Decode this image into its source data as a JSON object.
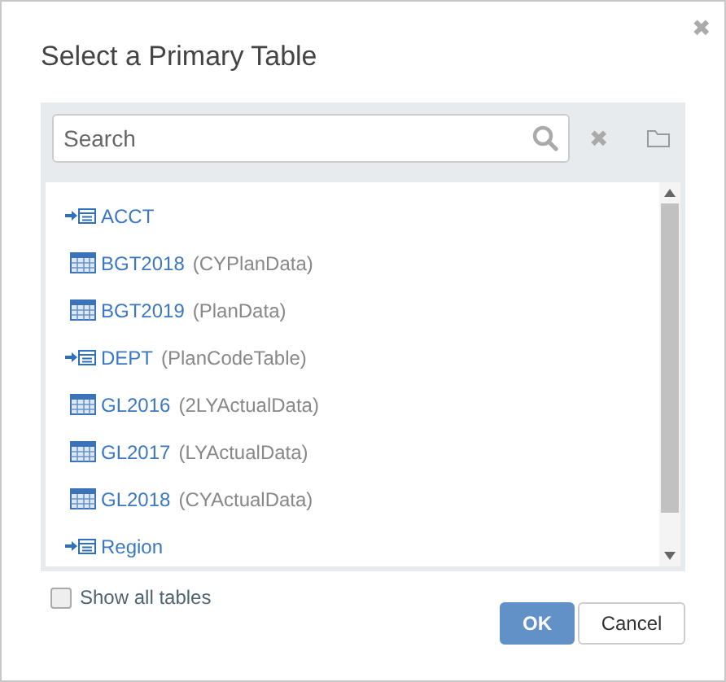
{
  "dialog": {
    "title": "Select a Primary Table",
    "close": "✖"
  },
  "search": {
    "placeholder": "Search",
    "clear": "✖"
  },
  "tables": [
    {
      "kind": "link",
      "name": "ACCT"
    },
    {
      "kind": "table",
      "name": "BGT2018",
      "alias": "(CYPlanData)"
    },
    {
      "kind": "table",
      "name": "BGT2019",
      "alias": "(PlanData)"
    },
    {
      "kind": "link",
      "name": "DEPT",
      "alias": "(PlanCodeTable)"
    },
    {
      "kind": "table",
      "name": "GL2016",
      "alias": "(2LYActualData)"
    },
    {
      "kind": "table",
      "name": "GL2017",
      "alias": "(LYActualData)"
    },
    {
      "kind": "table",
      "name": "GL2018",
      "alias": "(CYActualData)"
    },
    {
      "kind": "link",
      "name": "Region"
    }
  ],
  "show_all": {
    "label": "Show all tables",
    "checked": false
  },
  "buttons": [
    {
      "label": "OK",
      "kind": "primary"
    },
    {
      "label": "Cancel",
      "kind": "secondary"
    }
  ]
}
